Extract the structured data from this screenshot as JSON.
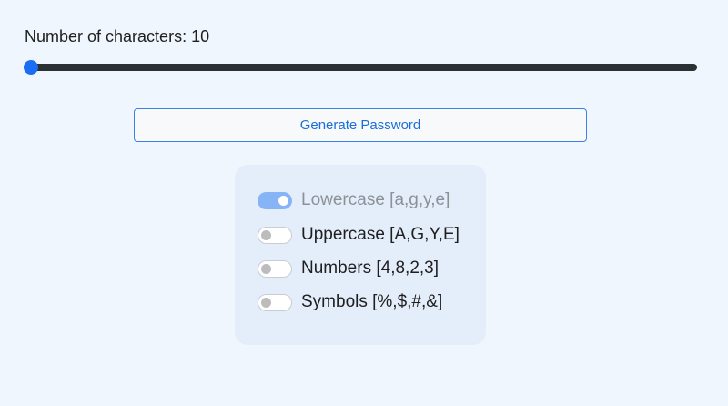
{
  "slider": {
    "label": "Number of characters: 10",
    "value": 10
  },
  "generate_button": {
    "label": "Generate Password"
  },
  "options": [
    {
      "label": "Lowercase [a,g,y,e]",
      "checked": true
    },
    {
      "label": "Uppercase [A,G,Y,E]",
      "checked": false
    },
    {
      "label": "Numbers [4,8,2,3]",
      "checked": false
    },
    {
      "label": "Symbols [%,$,#,&]",
      "checked": false
    }
  ],
  "colors": {
    "background": "#eff6fd",
    "accent": "#1b6ef3",
    "toggle_on": "#86b4f6",
    "panel": "#e4eefa"
  }
}
